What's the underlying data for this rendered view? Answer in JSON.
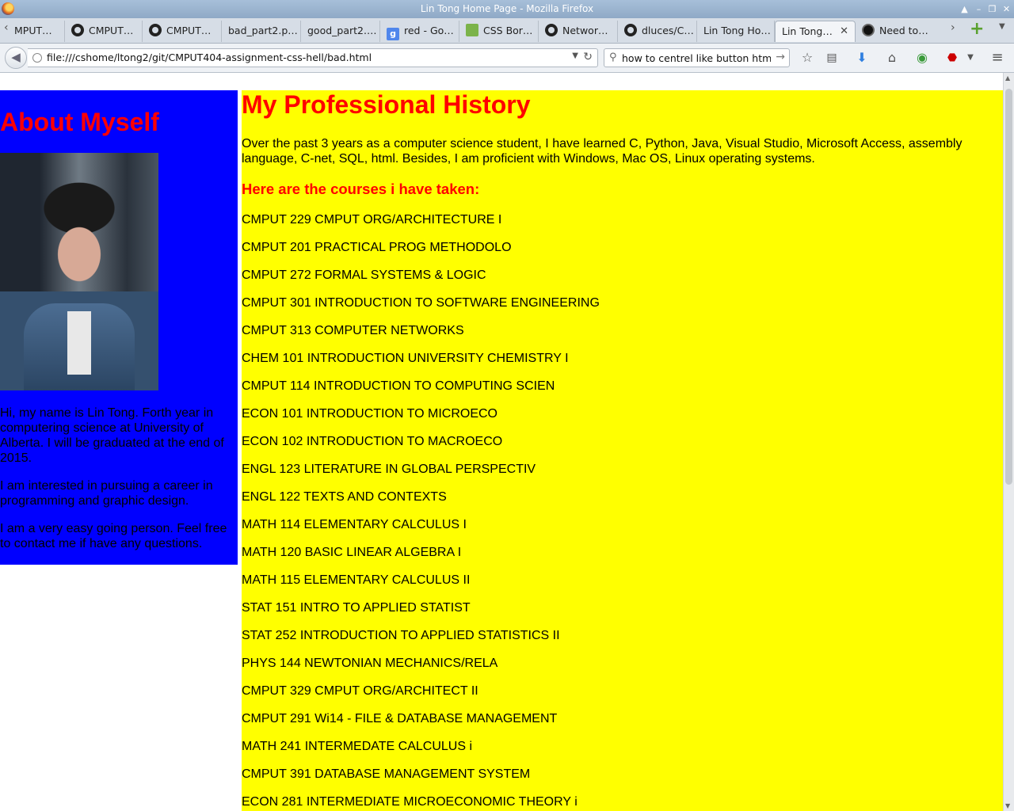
{
  "window": {
    "title": "Lin Tong Home Page - Mozilla Firefox"
  },
  "tabs": [
    {
      "label": "MPUT…",
      "icon": "none"
    },
    {
      "label": "CMPUT…",
      "icon": "github-icon"
    },
    {
      "label": "CMPUT…",
      "icon": "github-icon"
    },
    {
      "label": "bad_part2.p…",
      "icon": "none"
    },
    {
      "label": "good_part2.…",
      "icon": "none"
    },
    {
      "label": "red - Go…",
      "icon": "google-icon"
    },
    {
      "label": "CSS Bor…",
      "icon": "css-icon"
    },
    {
      "label": "Networ…",
      "icon": "github-icon"
    },
    {
      "label": "dluces/C…",
      "icon": "github-icon"
    },
    {
      "label": "Lin Tong Ho…",
      "icon": "none"
    },
    {
      "label": "Lin Tong…",
      "icon": "none",
      "active": true
    },
    {
      "label": "Need to…",
      "icon": "sound-icon"
    }
  ],
  "nav": {
    "url": "file:///cshome/ltong2/git/CMPUT404-assignment-css-hell/bad.html",
    "search_value": "how to centrel like button html"
  },
  "about": {
    "heading": "About Myself",
    "paragraphs": [
      "Hi, my name is Lin Tong. Forth year in computering science at University of Alberta. I will be graduated at the end of 2015.",
      "I am interested in pursuing a career in programming and graphic design.",
      "I am a very easy going person. Feel free to contact me if have any questions."
    ]
  },
  "history": {
    "heading": "My Professional History",
    "intro": "Over the past 3 years as a computer science student, I have learned C, Python, Java, Visual Studio, Microsoft Access, assembly language, C-net, SQL, html. Besides, I am proficient with Windows, Mac OS, Linux operating systems.",
    "courses_heading": "Here are the courses i have taken:",
    "courses": [
      "CMPUT 229 CMPUT ORG/ARCHITECTURE I",
      "CMPUT 201 PRACTICAL PROG METHODOLO",
      "CMPUT 272 FORMAL SYSTEMS & LOGIC",
      "CMPUT 301 INTRODUCTION TO SOFTWARE ENGINEERING",
      "CMPUT 313 COMPUTER NETWORKS",
      "CHEM 101 INTRODUCTION UNIVERSITY CHEMISTRY I",
      "CMPUT 114 INTRODUCTION TO COMPUTING SCIEN",
      "ECON 101 INTRODUCTION TO MICROECO",
      "ECON 102 INTRODUCTION TO MACROECO",
      "ENGL 123 LITERATURE IN GLOBAL PERSPECTIV",
      "ENGL 122 TEXTS AND CONTEXTS",
      "MATH 114 ELEMENTARY CALCULUS I",
      "MATH 120 BASIC LINEAR ALGEBRA I",
      "MATH 115 ELEMENTARY CALCULUS II",
      "STAT 151 INTRO TO APPLIED STATIST",
      "STAT 252 INTRODUCTION TO APPLIED STATISTICS II",
      "PHYS 144 NEWTONIAN MECHANICS/RELA",
      "CMPUT 329 CMPUT ORG/ARCHITECT II",
      "CMPUT 291 Wi14 - FILE & DATABASE MANAGEMENT",
      "MATH 241 INTERMEDATE CALCULUS i",
      "CMPUT 391 DATABASE MANAGEMENT SYSTEM",
      "ECON 281 INTERMEDIATE MICROECONOMIC THEORY i"
    ]
  }
}
